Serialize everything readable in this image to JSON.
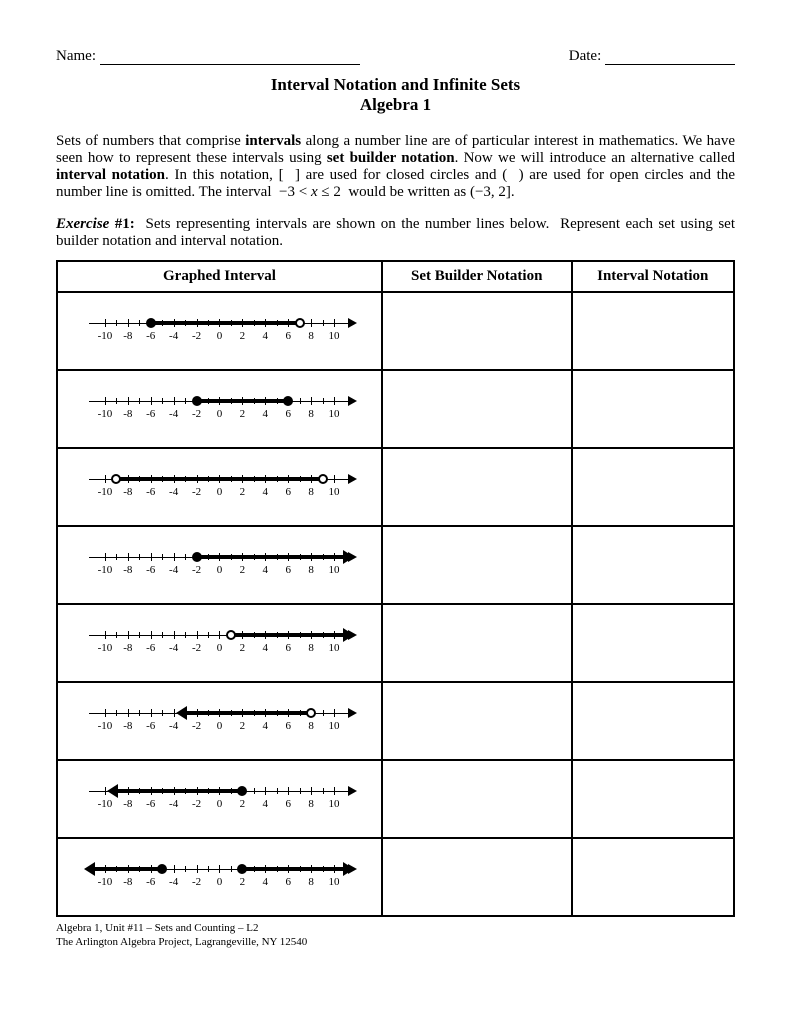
{
  "header": {
    "name_label": "Name:",
    "date_label": "Date:"
  },
  "title_line1": "Interval Notation and Infinite Sets",
  "title_line2": "Algebra 1",
  "intro_html": "Sets of numbers that comprise <b>intervals</b> along a number line are of particular interest in mathematics. We have seen how to represent these intervals using <b>set builder notation</b>. Now we will introduce an alternative called <b>interval notation</b>. In this notation, [&nbsp;&nbsp;] are used for closed circles and (&nbsp;&nbsp;) are used for open circles and the number line is omitted. The interval &nbsp;−3 &lt; <i>x</i> ≤ 2&nbsp; would be written as (−3, 2].",
  "exercise_html": "<b><i>Exercise</i> #1:</b>&nbsp; Sets representing intervals are shown on the number lines below.&nbsp; Represent each set using set builder notation and interval notation.",
  "columns": {
    "graph": "Graphed Interval",
    "set_builder": "Set Builder Notation",
    "interval": "Interval Notation"
  },
  "axis": {
    "min": -11,
    "max": 11,
    "ticks": [
      -10,
      -8,
      -6,
      -4,
      -2,
      0,
      2,
      4,
      6,
      8,
      10
    ],
    "small_ticks": [
      -9,
      -7,
      -5,
      -3,
      -1,
      1,
      3,
      5,
      7,
      9
    ]
  },
  "rows": [
    {
      "left": {
        "type": "closed",
        "at": -6
      },
      "right": {
        "type": "open",
        "at": 7
      }
    },
    {
      "left": {
        "type": "closed",
        "at": -2
      },
      "right": {
        "type": "closed",
        "at": 6
      }
    },
    {
      "left": {
        "type": "open",
        "at": -9
      },
      "right": {
        "type": "open",
        "at": 9
      }
    },
    {
      "left": {
        "type": "closed",
        "at": -2
      },
      "right": {
        "type": "arrow",
        "at": 11
      }
    },
    {
      "left": {
        "type": "open",
        "at": 1
      },
      "right": {
        "type": "arrow",
        "at": 11
      }
    },
    {
      "left": {
        "type": "arrow",
        "at": -3
      },
      "right": {
        "type": "open",
        "at": 8
      }
    },
    {
      "left": {
        "type": "arrow",
        "at": -9
      },
      "right": {
        "type": "closed",
        "at": 2
      }
    },
    {
      "left": {
        "type": "arrow",
        "at": -11
      },
      "right": {
        "type": "closed",
        "at": -5
      },
      "extra": {
        "type": "closed",
        "at": 2
      },
      "extra_to": {
        "type": "arrow",
        "at": 11
      }
    }
  ],
  "footer_line1": "Algebra 1, Unit #11 – Sets and Counting – L2",
  "footer_line2": "The Arlington Algebra Project, Lagrangeville, NY 12540"
}
